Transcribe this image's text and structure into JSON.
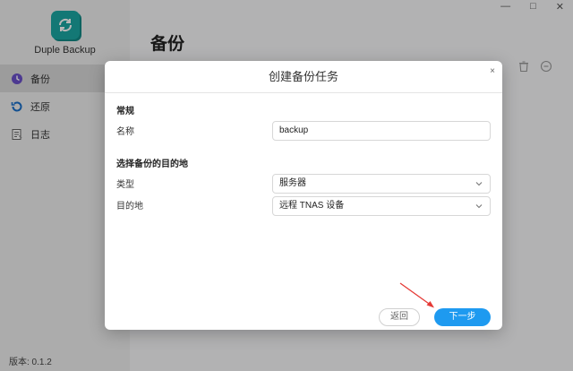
{
  "app": {
    "name": "Duple Backup",
    "version": "版本: 0.1.2"
  },
  "window": {
    "minimize": "—",
    "maximize": "□",
    "close": "✕"
  },
  "sidebar": {
    "items": [
      {
        "label": "备份",
        "icon": "clock-icon",
        "active": true
      },
      {
        "label": "还原",
        "icon": "restore-icon",
        "active": false
      },
      {
        "label": "日志",
        "icon": "log-icon",
        "active": false
      }
    ]
  },
  "main": {
    "title": "备份",
    "toolbar_icons": [
      "trash-icon",
      "more-icon"
    ]
  },
  "dialog": {
    "title": "创建备份任务",
    "close": "×",
    "general": {
      "section": "常规",
      "name_label": "名称",
      "name_value": "backup"
    },
    "destination": {
      "section": "选择备份的目的地",
      "type_label": "类型",
      "type_value": "服务器",
      "target_label": "目的地",
      "target_value": "远程 TNAS 设备"
    },
    "buttons": {
      "back": "返回",
      "next": "下一步"
    }
  },
  "colors": {
    "accent": "#1e9af0",
    "logo": "#1ba7a2",
    "annotation_arrow": "#e53935"
  }
}
